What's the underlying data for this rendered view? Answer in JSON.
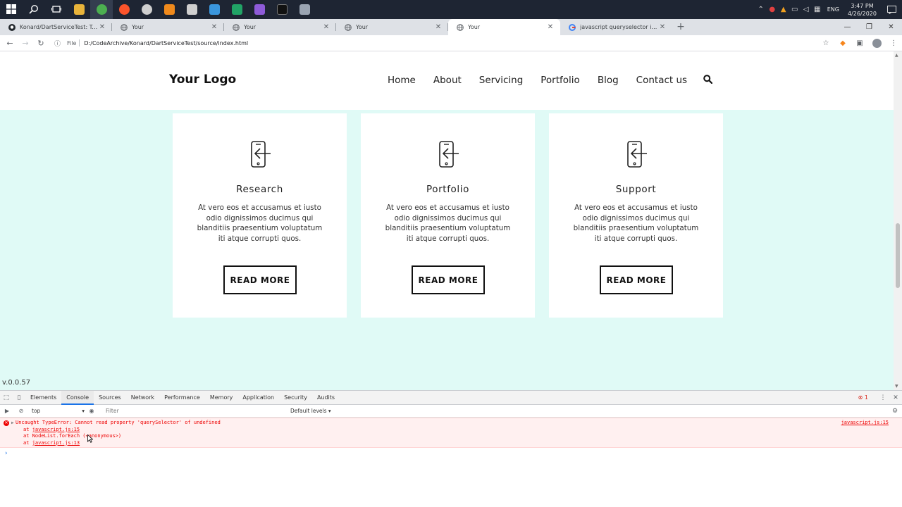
{
  "taskbar": {
    "apps": [
      {
        "name": "windows-start-icon",
        "color": "#ffffff"
      },
      {
        "name": "search-icon",
        "color": "#ffffff"
      },
      {
        "name": "task-view-icon",
        "color": "#ffffff"
      },
      {
        "name": "file-explorer-icon",
        "color": "#e8b33a"
      },
      {
        "name": "chrome-icon",
        "color": "#4caf50",
        "active": true
      },
      {
        "name": "brave-icon",
        "color": "#fb542b"
      },
      {
        "name": "obs-icon",
        "color": "#cfcfcf"
      },
      {
        "name": "vlc-icon",
        "color": "#f08a1c"
      },
      {
        "name": "calculator-icon",
        "color": "#cfcfcf"
      },
      {
        "name": "azure-icon",
        "color": "#3a96dd"
      },
      {
        "name": "excel-icon",
        "color": "#21a366"
      },
      {
        "name": "visual-studio-icon",
        "color": "#8e5bd8"
      },
      {
        "name": "terminal-icon",
        "color": "#111111"
      },
      {
        "name": "tool-icon",
        "color": "#9aa4b2"
      }
    ],
    "lang": "ENG",
    "time": "3:47 PM",
    "date": "4/26/2020"
  },
  "tabs": [
    {
      "title": "Konard/DartServiceTest: Test ver",
      "favicon": "github"
    },
    {
      "title": "Your",
      "favicon": "globe"
    },
    {
      "title": "Your",
      "favicon": "globe"
    },
    {
      "title": "Your",
      "favicon": "globe"
    },
    {
      "title": "Your",
      "favicon": "globe",
      "active": true
    },
    {
      "title": "javascript queryselector inside el",
      "favicon": "google"
    }
  ],
  "address": {
    "scheme": "File",
    "url": "D:/CodeArchive/Konard/DartServiceTest/source/index.html"
  },
  "site": {
    "logo": "Your Logo",
    "nav": [
      "Home",
      "About",
      "Servicing",
      "Portfolio",
      "Blog",
      "Contact us"
    ],
    "cards": [
      {
        "title": "Research",
        "text": "At vero eos et accusamus et iusto odio dignissimos ducimus qui blanditiis praesentium voluptatum iti atque corrupti quos.",
        "button": "READ MORE"
      },
      {
        "title": "Portfolio",
        "text": "At vero eos et accusamus et iusto odio dignissimos ducimus qui blanditiis praesentium voluptatum iti atque corrupti quos.",
        "button": "READ MORE"
      },
      {
        "title": "Support",
        "text": "At vero eos et accusamus et iusto odio dignissimos ducimus qui blanditiis praesentium voluptatum iti atque corrupti quos.",
        "button": "READ MORE"
      }
    ],
    "version": "v.0.0.57"
  },
  "devtools": {
    "tabs": [
      "Elements",
      "Console",
      "Sources",
      "Network",
      "Performance",
      "Memory",
      "Application",
      "Security",
      "Audits"
    ],
    "active_tab": "Console",
    "error_count": "1",
    "context": "top",
    "filter_placeholder": "Filter",
    "levels": "Default levels ▾",
    "error": {
      "message": "Uncaught TypeError: Cannot read property 'querySelector' of undefined",
      "stack": [
        {
          "prefix": "at ",
          "link": "javascript.js:15",
          "suffix": ""
        },
        {
          "prefix": "at NodeList.forEach ",
          "link": "",
          "suffix": "(<anonymous>)"
        },
        {
          "prefix": "at ",
          "link": "javascript.js:13",
          "suffix": ""
        }
      ],
      "source": "javascript.js:15"
    },
    "prompt": "›"
  },
  "colors": {
    "page_bg": "#e0faf6",
    "error_bg": "#fff0f0",
    "error_text": "#ee0000"
  }
}
